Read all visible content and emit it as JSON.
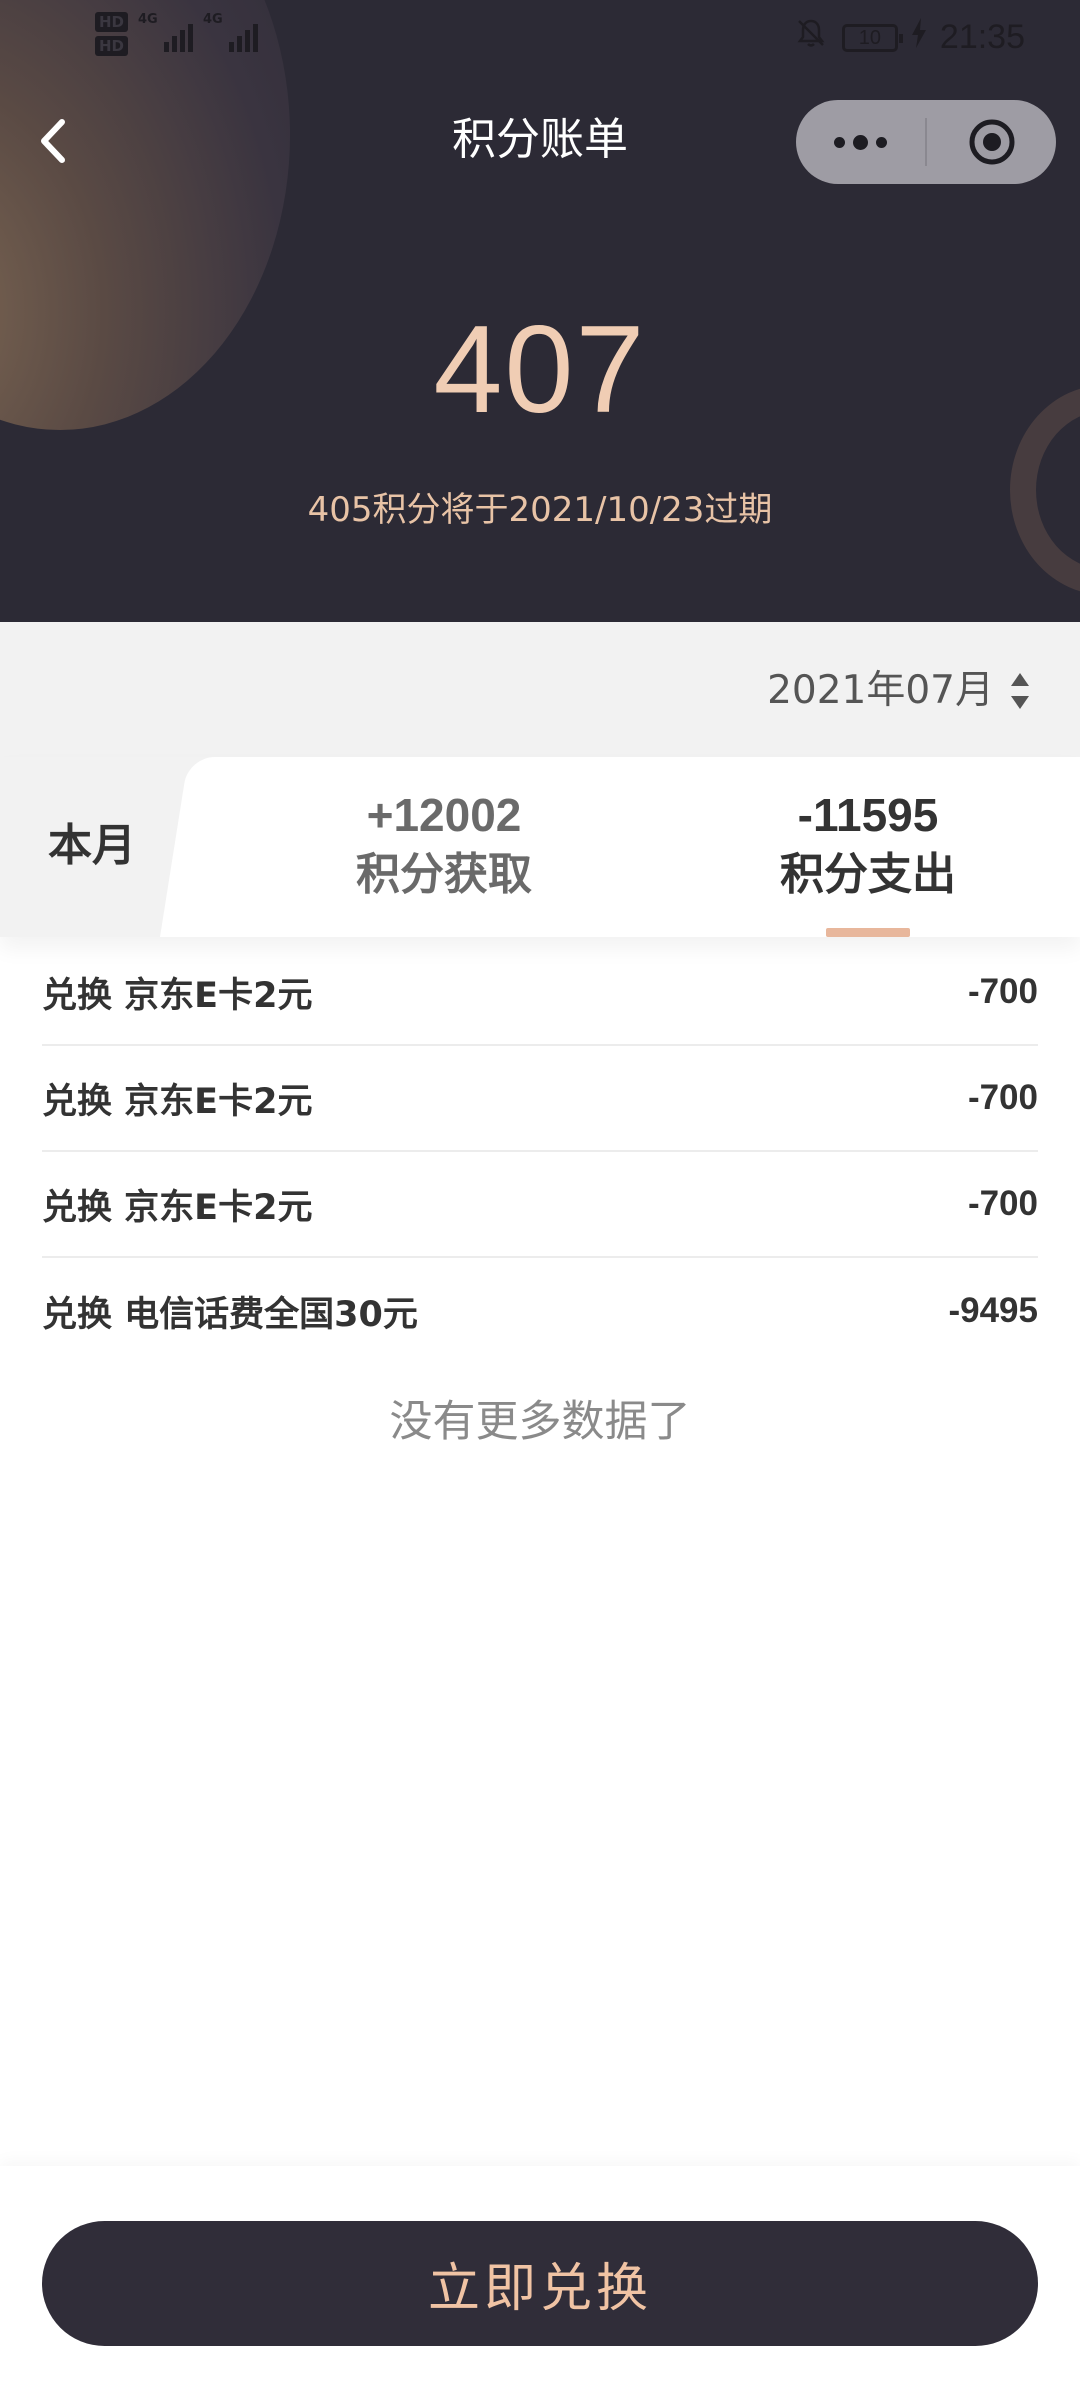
{
  "status_bar": {
    "hd_labels": [
      "HD",
      "HD"
    ],
    "network_labels": [
      "4G",
      "4G"
    ],
    "battery": "10",
    "time": "21:35"
  },
  "nav": {
    "title": "积分账单",
    "back_icon": "back-arrow-icon",
    "menu_icon": "more-dots-icon",
    "close_icon": "target-circle-icon"
  },
  "points": {
    "total": "407",
    "expire_note": "405积分将于2021/10/23过期"
  },
  "filter": {
    "month": "2021年07月"
  },
  "summary": {
    "period_label": "本月",
    "earned_value": "+12002",
    "earned_label": "积分获取",
    "spent_value": "-11595",
    "spent_label": "积分支出",
    "active_tab": "spent"
  },
  "transactions": [
    {
      "desc": "兑换 京东E卡2元",
      "amount": "-700"
    },
    {
      "desc": "兑换 京东E卡2元",
      "amount": "-700"
    },
    {
      "desc": "兑换 京东E卡2元",
      "amount": "-700"
    },
    {
      "desc": "兑换 电信话费全国30元",
      "amount": "-9495"
    }
  ],
  "empty_note": "没有更多数据了",
  "footer": {
    "redeem_label": "立即兑换"
  },
  "colors": {
    "header_bg": "#2c2a35",
    "accent": "#f0cdb4",
    "underline": "#e8b79c",
    "button_bg": "#302d39"
  }
}
